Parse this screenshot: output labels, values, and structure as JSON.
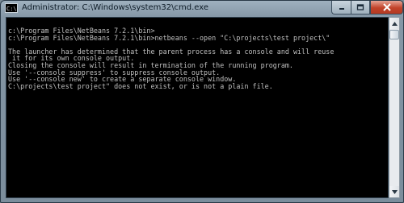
{
  "window": {
    "title": "Administrator: C:\\Windows\\system32\\cmd.exe",
    "icon": "cmd-icon"
  },
  "caption_buttons": {
    "minimize": "minimize-icon",
    "maximize": "maximize-icon",
    "close": "close-icon"
  },
  "console": {
    "lines": [
      "c:\\Program Files\\NetBeans 7.2.1\\bin>",
      "c:\\Program Files\\NetBeans 7.2.1\\bin>netbeans --open \"C:\\projects\\test project\\\"",
      "",
      "The launcher has determined that the parent process has a console and will reuse",
      " it for its own console output.",
      "Closing the console will result in termination of the running program.",
      "Use '--console suppress' to suppress console output.",
      "Use '--console new' to create a separate console window.",
      "C:\\projects\\test project\" does not exist, or is not a plain file."
    ]
  },
  "scrollbar": {
    "up_icon": "scroll-up-arrow-icon",
    "down_icon": "scroll-down-arrow-icon"
  }
}
